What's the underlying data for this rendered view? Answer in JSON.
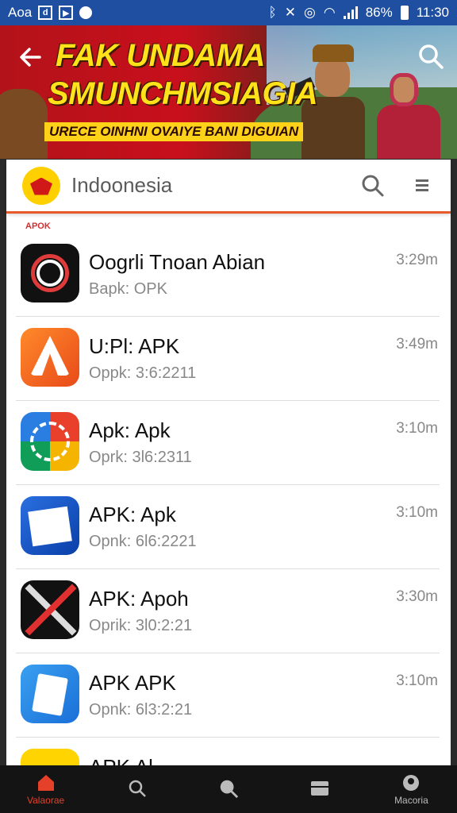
{
  "status_bar": {
    "left_text": "Aoa",
    "battery": "86%",
    "time": "11:30"
  },
  "banner": {
    "title_line1": "FAK UNDAMA",
    "title_line2": "SMUNCHMSIAGIA",
    "subtitle": "URECE OINHNI OVAIYE BANI DIGUIAN"
  },
  "search": {
    "text": "Indoonesia"
  },
  "list": {
    "section_label": "APOK",
    "items": [
      {
        "title": "Oogrli Tnoan Abian",
        "subtitle": "Bapk:   OPK",
        "time": "3:29m",
        "icon": "black-ring-icon"
      },
      {
        "title": "U:Pl: APK",
        "subtitle": "Oppk:   3:6:2211",
        "time": "3:49m",
        "icon": "orange-apk-icon"
      },
      {
        "title": "Apk: Apk",
        "subtitle": "Oprk:   3l6:2311",
        "time": "3:10m",
        "icon": "green-circle-icon"
      },
      {
        "title": "APK: Apk",
        "subtitle": "Opnk:   6l6:2221",
        "time": "3:10m",
        "icon": "blue-card-icon"
      },
      {
        "title": "APK: Apoh",
        "subtitle": "Oprik:   3l0:2:21",
        "time": "3:30m",
        "icon": "x-cross-icon"
      },
      {
        "title": "APK APK",
        "subtitle": "Opnk:   6l3:2:21",
        "time": "3:10m",
        "icon": "blue-doc-icon"
      },
      {
        "title": "APK Al",
        "subtitle": "",
        "time": "",
        "icon": "yellow-icon"
      }
    ]
  },
  "bottom_nav": {
    "home": "Valaorae",
    "profile": "Macoria"
  },
  "colors": {
    "status_bar": "#1f4fa0",
    "accent": "#e85a2a",
    "nav_active": "#e5402a"
  }
}
